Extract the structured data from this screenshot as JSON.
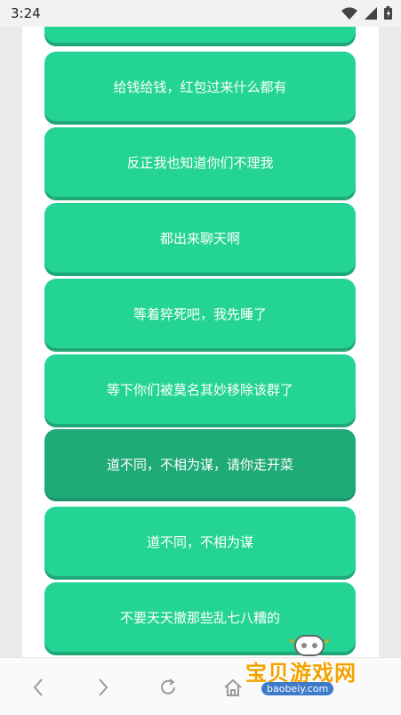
{
  "status_bar": {
    "time": "3:24"
  },
  "options": [
    {
      "label": ""
    },
    {
      "label": "给钱给钱，红包过来什么都有"
    },
    {
      "label": "反正我也知道你们不理我"
    },
    {
      "label": "都出来聊天啊"
    },
    {
      "label": "等着猝死吧，我先睡了"
    },
    {
      "label": "等下你们被莫名其妙移除该群了"
    },
    {
      "label": "道不同，不相为谋，请你走开菜"
    },
    {
      "label": "道不同，不相为谋"
    },
    {
      "label": "不要天天撤那些乱七八糟的"
    }
  ],
  "watermark": {
    "title": "宝贝游戏网",
    "domain": "baobeiy.com"
  },
  "colors": {
    "card": "#24d494",
    "card_active": "#1faa78",
    "watermark": "#f2a300"
  },
  "icons": [
    "wifi-icon",
    "signal-icon",
    "battery-icon",
    "back-icon",
    "forward-icon",
    "reload-icon",
    "home-icon"
  ]
}
